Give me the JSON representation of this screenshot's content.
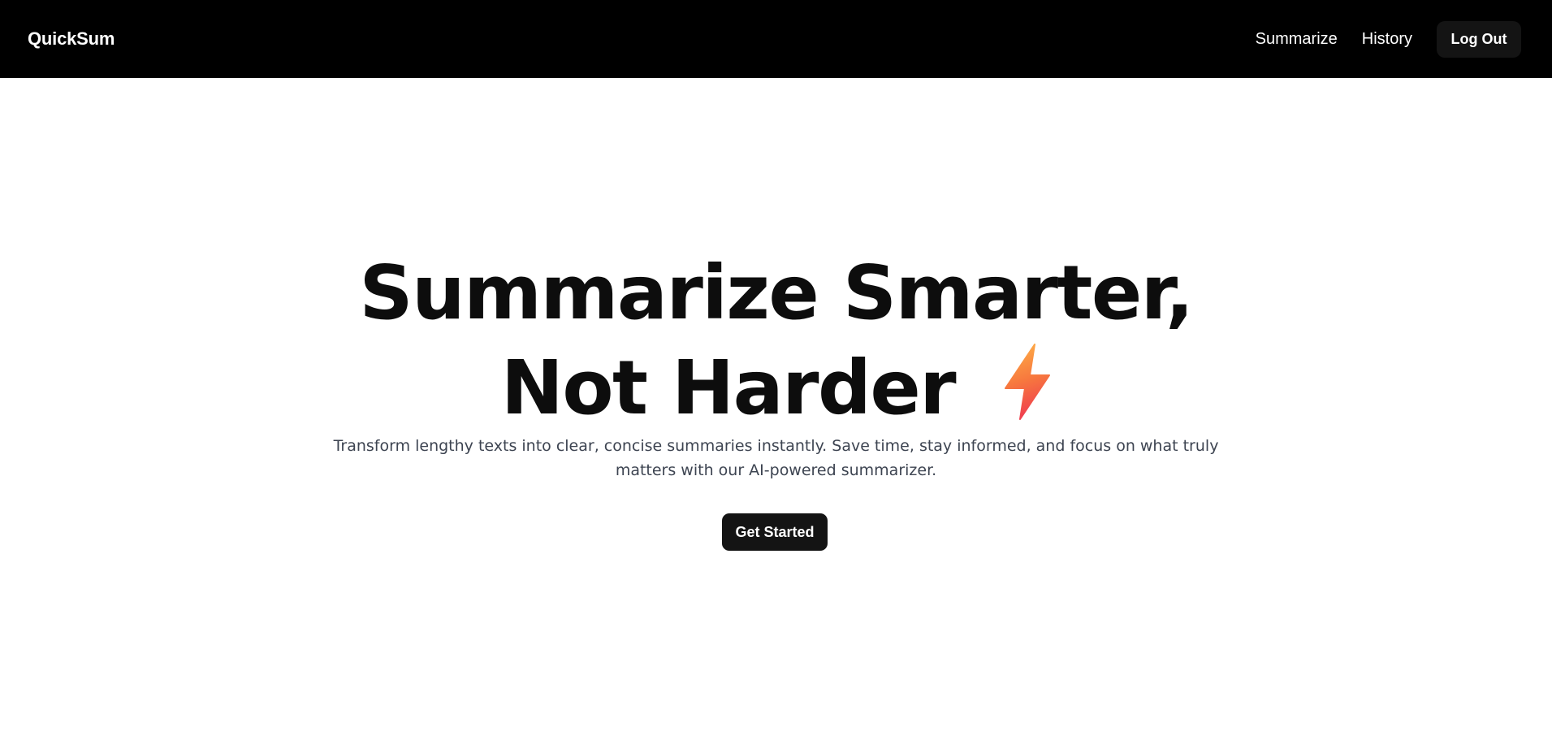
{
  "navbar": {
    "brand": "QuickSum",
    "links": [
      {
        "label": "Summarize"
      },
      {
        "label": "History"
      }
    ],
    "logout_label": "Log Out",
    "background_color": "#000000"
  },
  "hero": {
    "title_line1": "Summarize Smarter,",
    "title_line2": "Not Harder",
    "title_icon": "lightning-bolt-icon",
    "subtitle": "Transform lengthy texts into clear, concise summaries instantly. Save time, stay informed, and focus on what truly matters with our AI-powered summarizer.",
    "cta_label": "Get Started",
    "icon_gradient_colors": [
      "#ffb347",
      "#f0414f"
    ]
  }
}
